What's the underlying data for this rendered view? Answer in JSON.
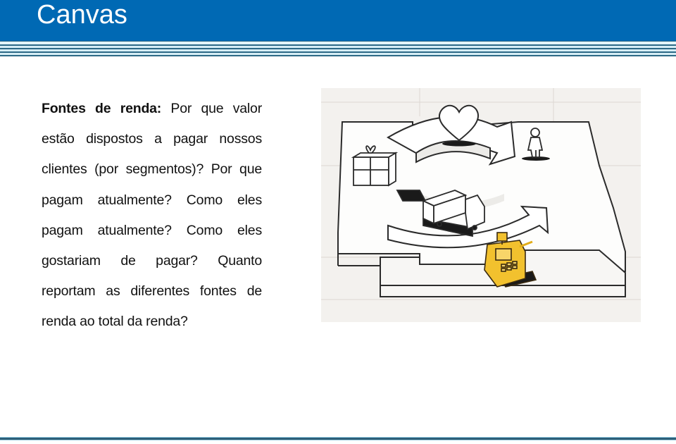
{
  "slide": {
    "title": "Canvas",
    "paragraph": {
      "bold_lead": "Fontes de renda:",
      "text": " Por que valor estão dispostos a pagar nossos clientes (por segmentos)? Por que pagam atualmente? Como eles pagam atualmente? Como eles gostariam de pagar? Quanto reportam as diferentes fontes de renda ao total da renda?"
    },
    "illustration": {
      "description": "Business model canvas sketch with heart, person, gift box, truck and highlighted cash register",
      "highlight_color": "#f2c12e",
      "icons": [
        "heart-icon",
        "person-icon",
        "gift-box-icon",
        "truck-icon",
        "cash-register-icon"
      ]
    }
  },
  "colors": {
    "header": "#0069b4",
    "stripe_dark": "#2d6a86",
    "stripe_light": "#d9f2f8",
    "text": "#111111"
  }
}
